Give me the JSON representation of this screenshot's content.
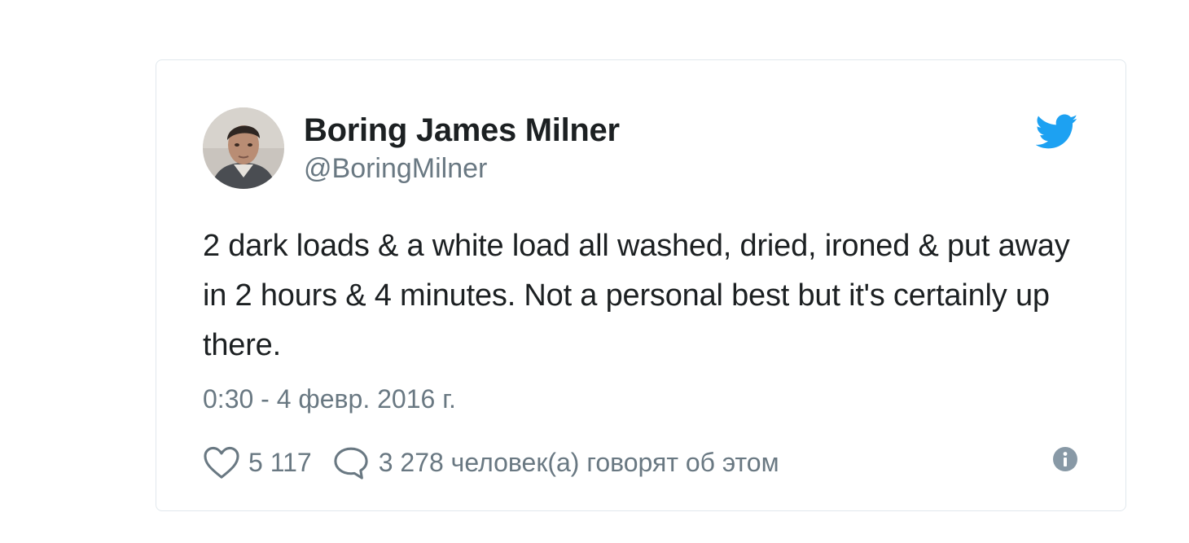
{
  "tweet": {
    "author": {
      "display_name": "Boring James Milner",
      "handle": "@BoringMilner",
      "avatar": "avatar-photo"
    },
    "brand_icon": "twitter-bird-icon",
    "text": "2 dark loads & a white load all washed, dried, ironed & put away in 2 hours & 4 minutes. Not a personal best but it's certainly up there.",
    "timestamp": "0:30 - 4 февр. 2016 г.",
    "actions": {
      "like_icon": "heart-icon",
      "like_count": "5 117",
      "reply_icon": "speech-bubble-icon",
      "reply_text": "3 278 человек(а) говорят об этом",
      "info_icon": "info-icon"
    }
  },
  "colors": {
    "twitter_blue": "#1da1f2",
    "text_primary": "#1c2022",
    "text_secondary": "#697882",
    "card_border": "#e1e8ed"
  }
}
